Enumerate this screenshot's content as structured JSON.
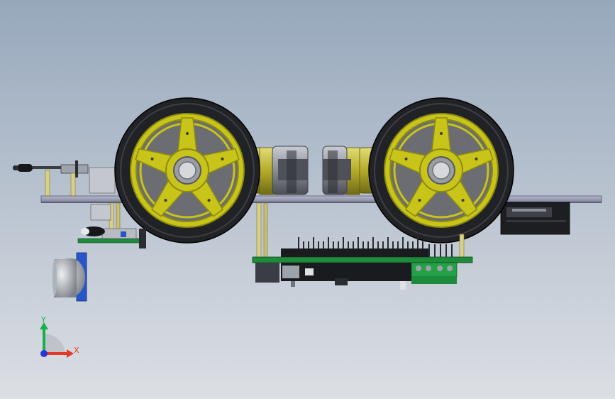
{
  "viewport": {
    "background_top": "#97a8bc",
    "background_bottom": "#dcdfe4"
  },
  "colors": {
    "wheel_yellow": "#c8c41a",
    "wheel_yellow_dark": "#8c8a12",
    "tire": "#202226",
    "chassis_plate": "#8e91a8",
    "pcb_green": "#1f8a3a",
    "motor_yellow": "#b7ad2c",
    "motor_gray": "#7c7f86",
    "dark": "#15171a",
    "standoff": "#d9cf86"
  },
  "triad": {
    "y_label": "Y",
    "x_label": "X",
    "y_color": "#17b04a",
    "x_color": "#e23a2a",
    "origin_color": "#2737d8"
  }
}
